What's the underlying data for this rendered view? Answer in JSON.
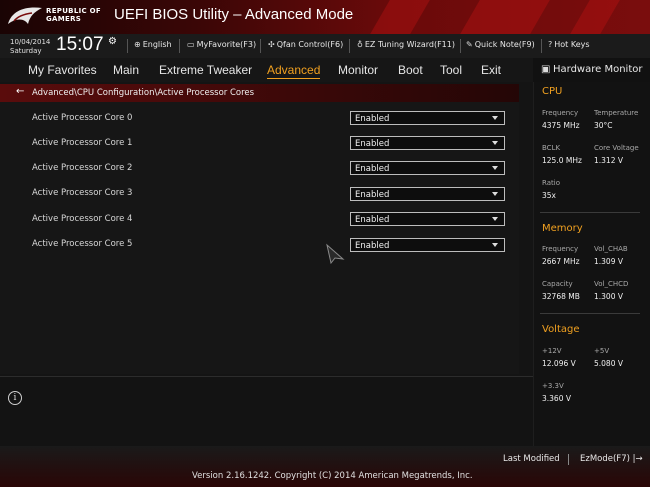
{
  "header": {
    "brand_line1": "REPUBLIC OF",
    "brand_line2": "GAMERS",
    "title": "UEFI BIOS Utility – Advanced Mode"
  },
  "infobar": {
    "date": "10/04/2014",
    "day": "Saturday",
    "time": "15:07",
    "tools": [
      {
        "label": "English",
        "icon": "globe-icon"
      },
      {
        "label": "MyFavorite(F3)",
        "icon": "favorite-icon"
      },
      {
        "label": "Qfan Control(F6)",
        "icon": "fan-icon"
      },
      {
        "label": "EZ Tuning Wizard(F11)",
        "icon": "lightbulb-icon"
      },
      {
        "label": "Quick Note(F9)",
        "icon": "note-icon"
      },
      {
        "label": "Hot Keys",
        "icon": "help-icon"
      }
    ]
  },
  "menu": {
    "items": [
      "My Favorites",
      "Main",
      "Extreme Tweaker",
      "Advanced",
      "Monitor",
      "Boot",
      "Tool",
      "Exit"
    ],
    "active": "Advanced"
  },
  "breadcrumb": "Advanced\\CPU Configuration\\Active Processor Cores",
  "settings": [
    {
      "label": "Active Processor Core 0",
      "value": "Enabled"
    },
    {
      "label": "Active Processor Core 1",
      "value": "Enabled"
    },
    {
      "label": "Active Processor Core 2",
      "value": "Enabled"
    },
    {
      "label": "Active Processor Core 3",
      "value": "Enabled"
    },
    {
      "label": "Active Processor Core 4",
      "value": "Enabled"
    },
    {
      "label": "Active Processor Core 5",
      "value": "Enabled"
    }
  ],
  "hardware_monitor": {
    "title": "Hardware Monitor",
    "cpu": {
      "heading": "CPU",
      "frequency_label": "Frequency",
      "frequency": "4375 MHz",
      "temperature_label": "Temperature",
      "temperature": "30°C",
      "bclk_label": "BCLK",
      "bclk": "125.0 MHz",
      "core_voltage_label": "Core Voltage",
      "core_voltage": "1.312 V",
      "ratio_label": "Ratio",
      "ratio": "35x"
    },
    "memory": {
      "heading": "Memory",
      "frequency_label": "Frequency",
      "frequency": "2667 MHz",
      "vol_chab_label": "Vol_CHAB",
      "vol_chab": "1.309 V",
      "capacity_label": "Capacity",
      "capacity": "32768 MB",
      "vol_chcd_label": "Vol_CHCD",
      "vol_chcd": "1.300 V"
    },
    "voltage": {
      "heading": "Voltage",
      "v12_label": "+12V",
      "v12": "12.096 V",
      "v5_label": "+5V",
      "v5": "5.080 V",
      "v33_label": "+3.3V",
      "v33": "3.360 V"
    }
  },
  "footer": {
    "last_modified": "Last Modified",
    "ezmode": "EzMode(F7)",
    "version": "Version 2.16.1242. Copyright (C) 2014 American Megatrends, Inc."
  },
  "colors": {
    "accent": "#f0a020",
    "header_red": "#7a0d0d"
  }
}
